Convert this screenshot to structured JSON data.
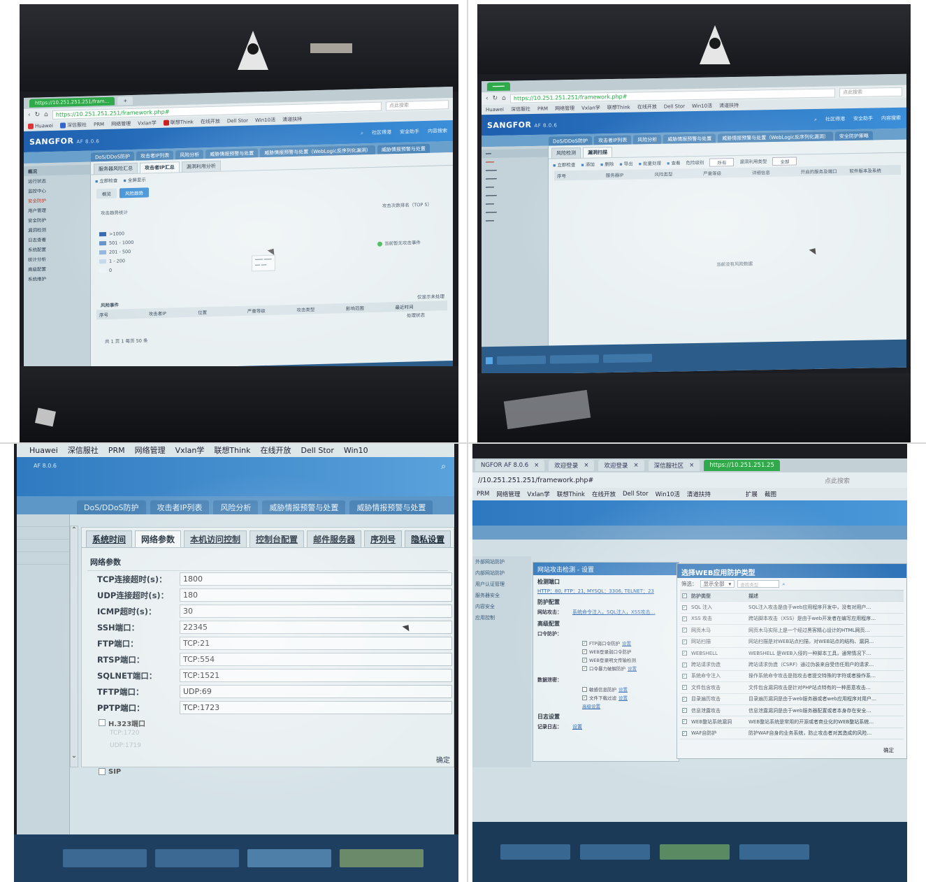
{
  "q1": {
    "tabs": [
      "https://10.251.251.251/fram...",
      "+"
    ],
    "url": "https://10.251.251.251/framework.php#",
    "search_placeholder": "点此搜索",
    "bookmarks": [
      "Huawei",
      "深信服社",
      "PRM",
      "网络管理",
      "Vxlan学",
      "联想Think",
      "在线开放",
      "Dell Stor",
      "Win10活",
      "清道扶持"
    ],
    "logo": "SANGFOR",
    "logo_sub": "AF 8.0.6",
    "header_menus": [
      "社区得港",
      "安全助手",
      "内容搜索"
    ],
    "module_tabs": [
      "DoS/DDoS防护",
      "攻击者IP列表",
      "风险分析",
      "威胁情报预警与处置",
      "威胁情报预警与处置（WebLogic反序列化漏洞）",
      "威胁情报预警与处置"
    ],
    "sidebar": [
      "概况",
      "运行状态",
      "监控中心",
      "安全防护",
      "用户管理",
      "安全防护",
      "漏洞检测",
      "日志查看",
      "系统配置",
      "统计分析",
      "高级配置",
      "系统维护"
    ],
    "subtabs": [
      "服务器风险汇总",
      "攻击者IP汇总",
      "漏洞利用分析"
    ],
    "toolbar": [
      "立即检查",
      "全屏显示"
    ],
    "pills": [
      "概览",
      "风险趋势"
    ],
    "trend_label": "攻击趋势统计",
    "top_label": "攻击次数排名（TOP 5）",
    "legend": [
      ">1000",
      "501 - 1000",
      "201 - 500",
      "1 - 200",
      "0"
    ],
    "no_data": "当前暂无攻击事件",
    "section": "风险事件",
    "grid_cols": [
      "序号",
      "攻击者IP",
      "位置",
      "严重等级",
      "攻击类型",
      "影响范围",
      "最近时间"
    ],
    "grid_right": [
      "仅显示未处理",
      "处理状态"
    ],
    "pager": "共 1 页  1  每页 50 条"
  },
  "q2": {
    "url": "https://10.251.251.251/framework.php#",
    "search_placeholder": "点此搜索",
    "bookmarks": [
      "Huawei",
      "深信服社",
      "PRM",
      "网络管理",
      "Vxlan学",
      "联想Think",
      "在线开放",
      "Dell Stor",
      "Win10活",
      "清道扶持"
    ],
    "logo": "SANGFOR",
    "logo_sub": "AF 8.0.6",
    "header_menus": [
      "社区得港",
      "安全助手",
      "内容搜索"
    ],
    "module_tabs": [
      "DoS/DDoS防护",
      "攻击者IP列表",
      "风险分析",
      "威胁情报预警与处置",
      "威胁情报预警与处置（WebLogic反序列化漏洞）",
      "安全防护策略"
    ],
    "subtabs": [
      "风险检测",
      "漏洞扫描"
    ],
    "toolbar": [
      "立即检查",
      "添加",
      "删除",
      "导出",
      "批量处理",
      "查看"
    ],
    "filter_label": "危险级别",
    "filter_value": "所有",
    "filter2_label": "漏洞利用类型",
    "filter2_value": "全部",
    "grid_cols": [
      "序号",
      "服务器IP",
      "风险类型",
      "严重等级",
      "详细信息",
      "开启的服务及端口",
      "软件版本及系统"
    ],
    "empty": "当前没有风险数据"
  },
  "q3": {
    "bookmarks": [
      "Huawei",
      "深信服社",
      "PRM",
      "网络管理",
      "Vxlan学",
      "联想Think",
      "在线开放",
      "Dell Stor",
      "Win10"
    ],
    "header_sub": "AF 8.0.6",
    "module_tabs": [
      "DoS/DDoS防护",
      "攻击者IP列表",
      "风险分析",
      "威胁情报预警与处置",
      "威胁情报预警与处置"
    ],
    "subtabs": [
      "系统时间",
      "网络参数",
      "本机访问控制",
      "控制台配置",
      "邮件服务器",
      "序列号",
      "隐私设置"
    ],
    "section": "网络参数",
    "fields": [
      {
        "label": "TCP连接超时(s)：",
        "value": "1800"
      },
      {
        "label": "UDP连接超时(s)：",
        "value": "180"
      },
      {
        "label": "ICMP超时(s)：",
        "value": "30"
      },
      {
        "label": "SSH端口：",
        "value": "22345"
      },
      {
        "label": "FTP端口：",
        "value": "TCP:21"
      },
      {
        "label": "RTSP端口：",
        "value": "TCP:554"
      },
      {
        "label": "SQLNET端口：",
        "value": "TCP:1521"
      },
      {
        "label": "TFTP端口：",
        "value": "UDP:69"
      },
      {
        "label": "PPTP端口：",
        "value": "TCP:1723"
      }
    ],
    "h323_label": "H.323端口",
    "sip_label": "SIP",
    "faded_lines": [
      "TCP:1720",
      "UDP:1719"
    ],
    "footer_button": "确定"
  },
  "q4": {
    "tabs": [
      "NGFOR AF 8.0.6",
      "欢迎登录",
      "欢迎登录",
      "深信服社区",
      "https://10.251.251.25"
    ],
    "url": "//10.251.251.251/framework.php#",
    "search_placeholder": "点此搜索",
    "bookmarks": [
      "PRM",
      "网络管理",
      "Vxlan学",
      "联想Think",
      "在线开放",
      "Dell Stor",
      "Win10活",
      "清道扶持",
      "扩展",
      "截图"
    ],
    "left_items": [
      "外部网站防护",
      "内部网站防护",
      "用户认证管理",
      "服务器安全",
      "内容安全",
      "应用控制"
    ],
    "dialog": {
      "title": "网站攻击检测 - 设置",
      "sec1": "检测端口",
      "ports": "HTTP：80, FTP：21, MYSQL：3306, TELNET：23",
      "sec2": "防护配置",
      "kv_key": "网站攻击：",
      "kv_val": "系统命令注入，SQL注入，XSS攻击…",
      "sec3": "高级配置",
      "kv2_key": "口令防护：",
      "checks": [
        {
          "label": "FTP弱口令防护",
          "link": "设置",
          "checked": "✓"
        },
        {
          "label": "WEB登录弱口令防护",
          "link": "",
          "checked": "✓"
        },
        {
          "label": "WEB登录明文传输检测",
          "link": "",
          "checked": "✓"
        },
        {
          "label": "口令暴力破解防护",
          "link": "设置",
          "checked": "✓"
        }
      ],
      "kv3_key": "数据泄密：",
      "checks2": [
        {
          "label": "敏感信息防护",
          "link": "设置",
          "checked": ""
        },
        {
          "label": "文件下载过滤",
          "link": "设置",
          "checked": "✓"
        }
      ],
      "more_link": "高级设置",
      "sec4": "日志设置",
      "kv4_key": "记录日志：",
      "kv4_val": "设置"
    },
    "popup": {
      "title": "选择WEB应用防护类型",
      "filter_label": "筛选：",
      "filter_value": "显示全部",
      "search_placeholder": "查找类型",
      "head": [
        "防护类型",
        "描述"
      ],
      "rows": [
        {
          "name": "SQL 注入",
          "desc": "SQL注入攻击是由于web应用程序开发中，没有对用户…"
        },
        {
          "name": "XSS 攻击",
          "desc": "跨站脚本攻击（XSS）是由于web开发者在编写应用程序…"
        },
        {
          "name": "网页木马",
          "desc": "网页木马实际上是一个经过黑客精心设计的HTML网页…"
        },
        {
          "name": "网站扫描",
          "desc": "网站扫描是对WEB站点扫描，对WEB站点的结构、漏洞…"
        },
        {
          "name": "WEBSHELL",
          "desc": "WEBSHELL 是WEB入侵的一种脚本工具，通常情况下…"
        },
        {
          "name": "跨站请求伪造",
          "desc": "跨站请求伪造（CSRF）通过伪装来自受信任用户的请求…"
        },
        {
          "name": "系统命令注入",
          "desc": "操作系统命令攻击是指攻击者提交特殊的字符或者操作系…"
        },
        {
          "name": "文件包含攻击",
          "desc": "文件包含漏洞攻击是针对PHP站点特有的一种恶意攻击…"
        },
        {
          "name": "目录遍历攻击",
          "desc": "目录遍历漏洞是由于web服务器或者web应用程序对用户…"
        },
        {
          "name": "信息泄露攻击",
          "desc": "信息泄露漏洞是由于web服务器配置或者本身存在安全…"
        },
        {
          "name": "WEB整站系统漏洞",
          "desc": "WEB整站系统是常用的开源或者商业化的WEB整站系统…"
        },
        {
          "name": "WAF自防护",
          "desc": "防护WAF自身的业务系统，防止攻击者对其造成的风险…"
        }
      ],
      "footer": "确定"
    }
  }
}
